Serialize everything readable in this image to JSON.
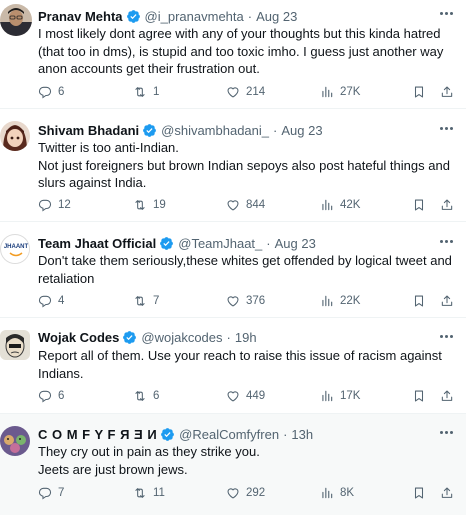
{
  "tweets": [
    {
      "name": "Pranav Mehta",
      "handle": "@i_pranavmehta",
      "date": "Aug 23",
      "lines": [
        "I most likely dont agree with any of your thoughts but this kinda hatred",
        "(that too in dms), is stupid and too toxic imho. I guess just another way",
        "anon accounts get their frustration out."
      ],
      "replies": "6",
      "retweets": "1",
      "likes": "214",
      "views": "27K"
    },
    {
      "name": "Shivam Bhadani",
      "handle": "@shivambhadani_",
      "date": "Aug 23",
      "lines": [
        "Twitter is too anti-Indian.",
        "Not just foreigners but brown Indian sepoys also post hateful things and",
        "slurs against India."
      ],
      "replies": "12",
      "retweets": "19",
      "likes": "844",
      "views": "42K"
    },
    {
      "name": "Team Jhaat Official",
      "handle": "@TeamJhaat_",
      "date": "Aug 23",
      "avatar_text": "JHAANT",
      "lines": [
        "Don't take them seriously,these whites get offended by logical tweet and",
        "retaliation"
      ],
      "replies": "4",
      "retweets": "7",
      "likes": "376",
      "views": "22K"
    },
    {
      "name": "Wojak Codes",
      "handle": "@wojakcodes",
      "date": "19h",
      "lines": [
        "Report all of them. Use your reach to raise this issue of racism against",
        "Indians."
      ],
      "replies": "6",
      "retweets": "6",
      "likes": "449",
      "views": "17K"
    },
    {
      "name": "C O M F Y F Я Ǝ И",
      "handle": "@RealComfyfren",
      "date": "13h",
      "lines": [
        "They cry out in pain as they strike you.",
        "Jeets are just brown jews."
      ],
      "replies": "7",
      "retweets": "11",
      "likes": "292",
      "views": "8K"
    }
  ],
  "colors": {
    "verified": "#1d9bf0",
    "text": "#0f1419",
    "muted": "#536471",
    "divider": "#eff3f4",
    "highlight_bg": "#f7f9f9"
  },
  "icons": [
    "verified-badge-icon",
    "more-icon",
    "reply-icon",
    "retweet-icon",
    "like-icon",
    "views-icon",
    "bookmark-icon",
    "share-icon"
  ]
}
